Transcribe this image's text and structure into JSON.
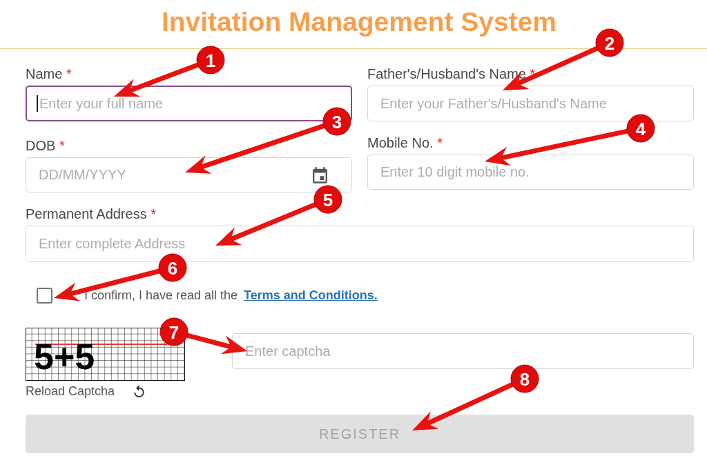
{
  "title": "Invitation Management System",
  "fields": [
    {
      "kind": "text",
      "label": "Name",
      "required_mark": "*",
      "placeholder": "Enter your full name",
      "focused": true
    },
    {
      "kind": "text",
      "label": "Father's/Husband's Name",
      "required_mark": "*",
      "placeholder": "Enter your Father's/Husband's Name",
      "focused": false
    },
    {
      "kind": "date",
      "label": "DOB",
      "required_mark": "*",
      "placeholder": "DD/MM/YYYY",
      "focused": false
    },
    {
      "kind": "text",
      "label": "Mobile No.",
      "required_mark": "*",
      "placeholder": "Enter 10 digit mobile no.",
      "focused": false
    },
    {
      "kind": "text",
      "label": "Permanent Address",
      "required_mark": "*",
      "placeholder": "Enter complete Address",
      "focused": false
    }
  ],
  "terms": {
    "checked": false,
    "text": "I confirm, I have read all the",
    "link": "Terms and Conditions."
  },
  "captcha": {
    "image_text": "5+5",
    "placeholder": "Enter captcha",
    "reload_label": "Reload Captcha"
  },
  "register_button": {
    "label": "REGISTER",
    "disabled": true
  },
  "callouts": [
    {
      "number": "1"
    },
    {
      "number": "2"
    },
    {
      "number": "3"
    },
    {
      "number": "4"
    },
    {
      "number": "5"
    },
    {
      "number": "6"
    },
    {
      "number": "7"
    },
    {
      "number": "8"
    }
  ]
}
